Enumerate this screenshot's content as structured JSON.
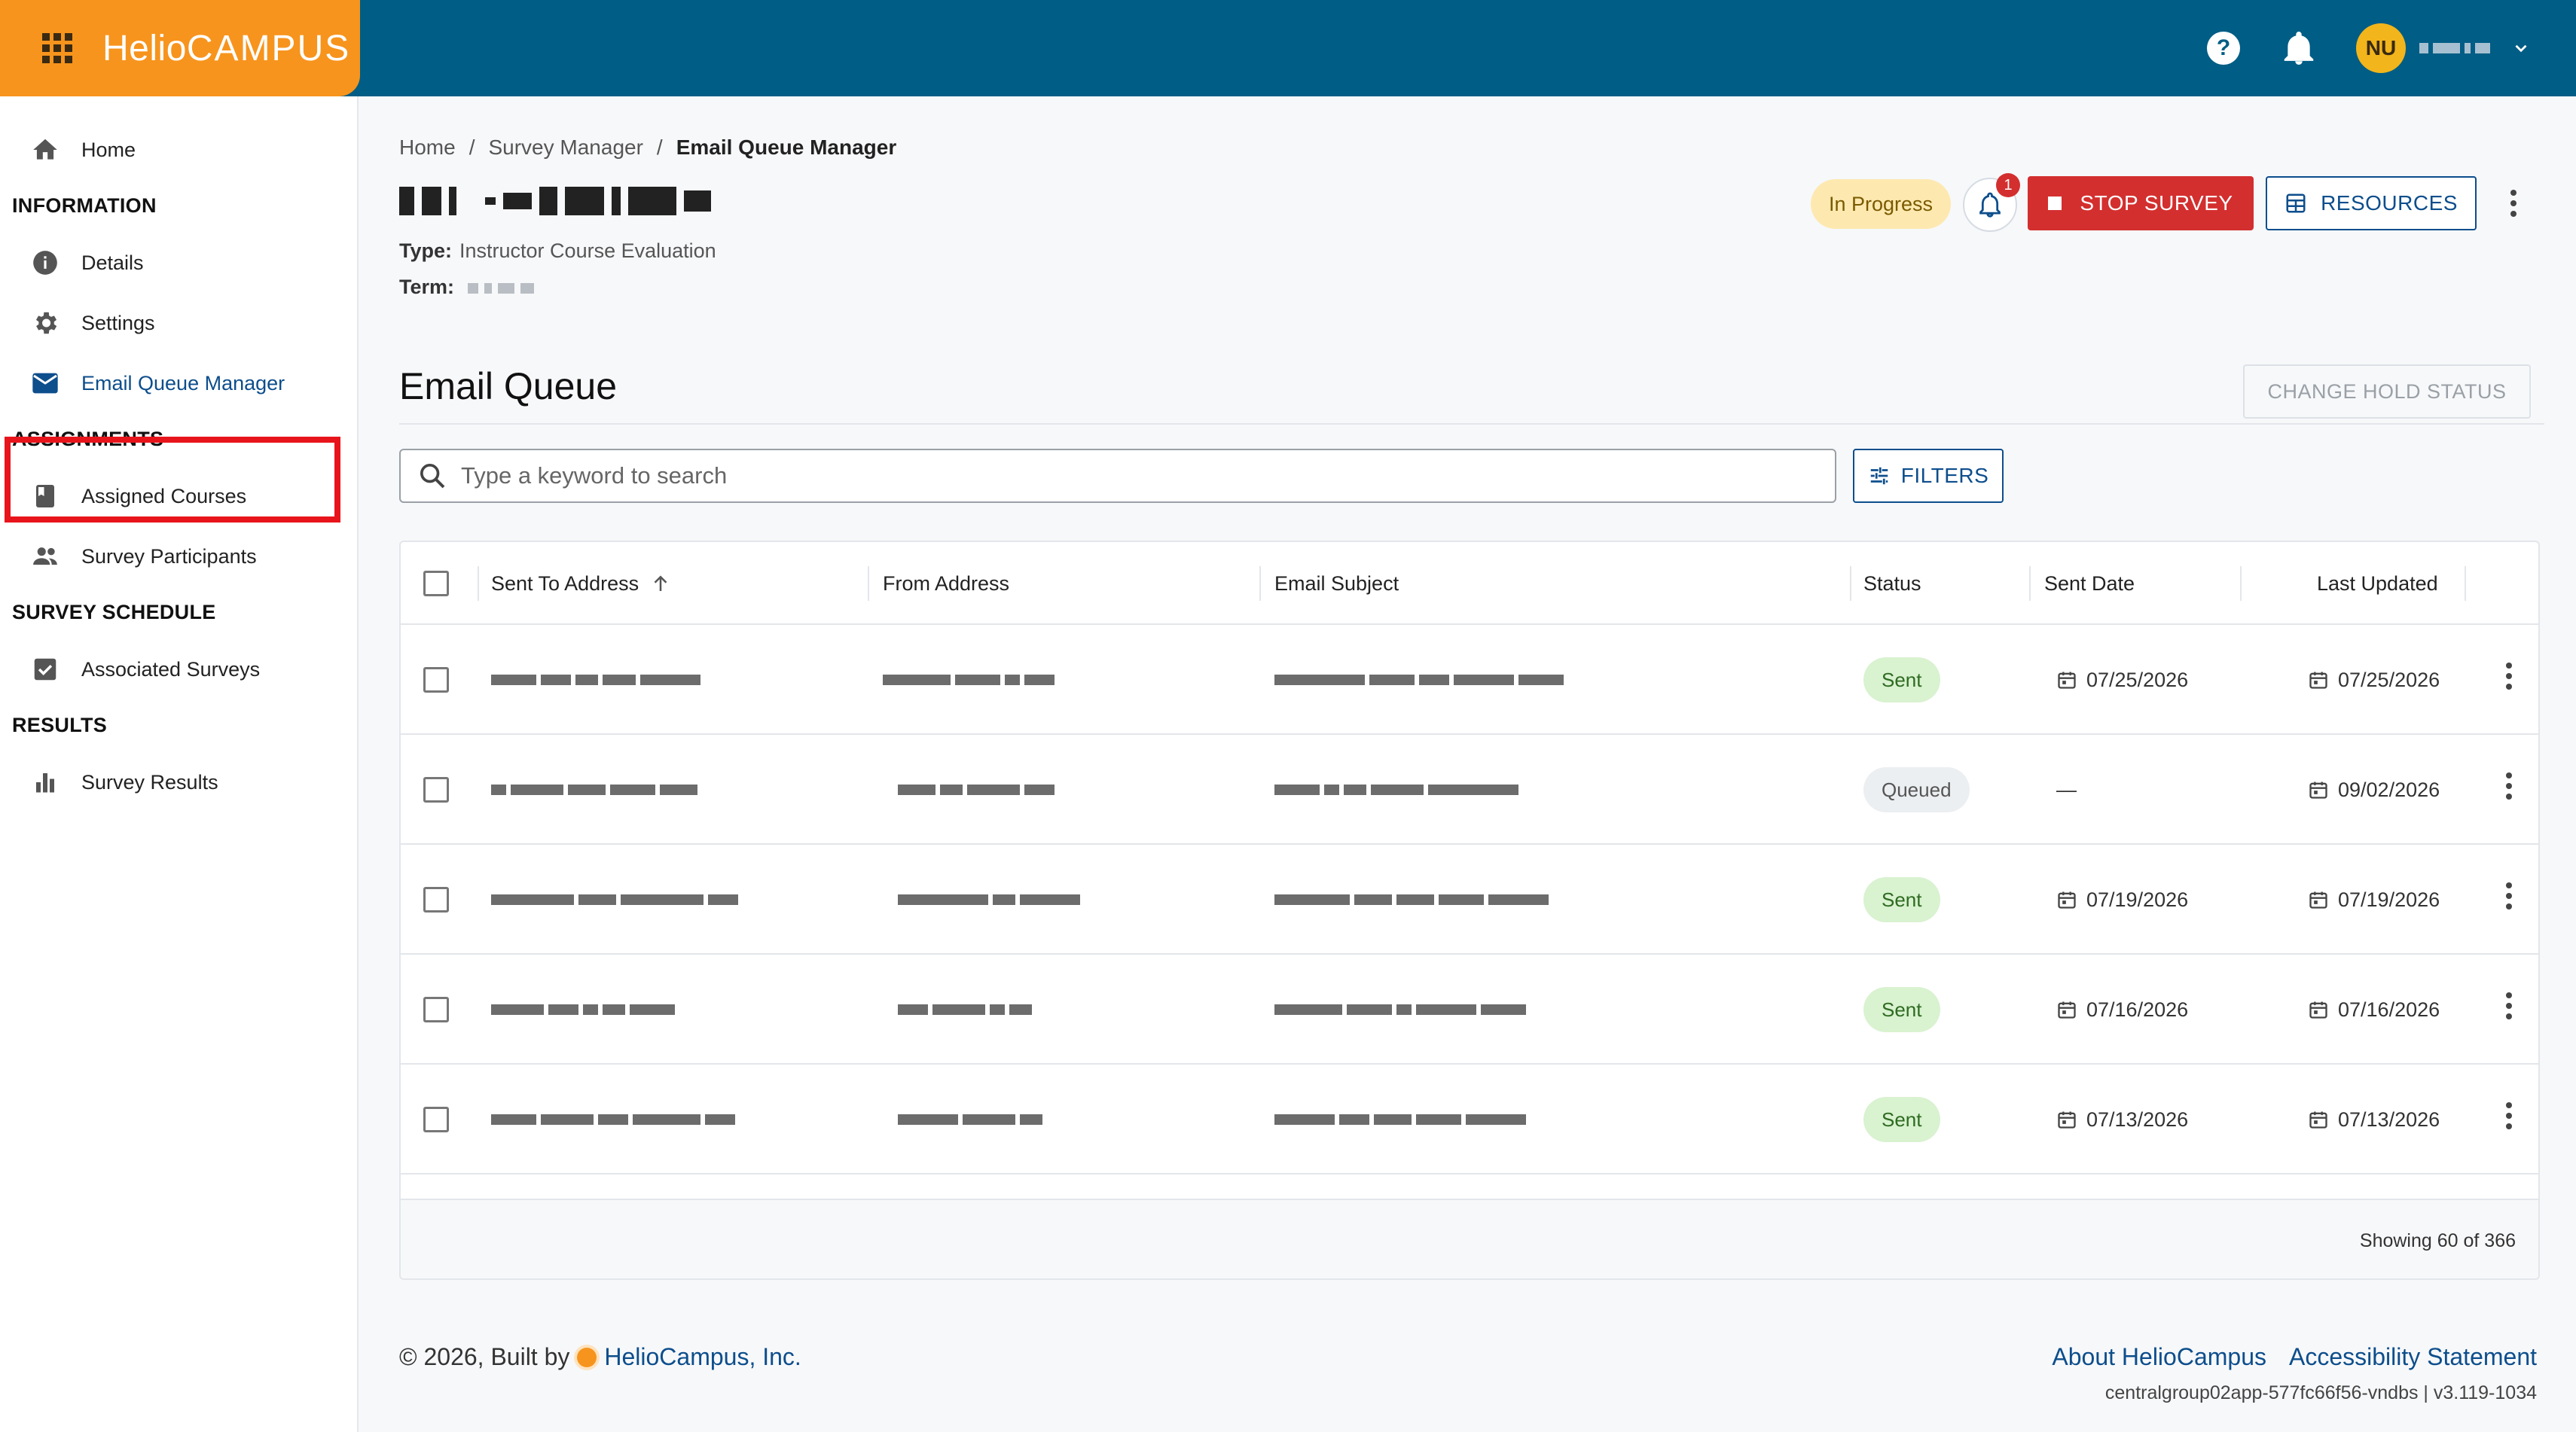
{
  "app": {
    "logo_part1": "Helio",
    "logo_part2": "CAMPUS",
    "user_initials": "NU",
    "brand_color": "#f7941d",
    "topbar_color": "#005d85"
  },
  "sidebar": {
    "home": "Home",
    "section_information": "INFORMATION",
    "details": "Details",
    "settings": "Settings",
    "email_queue_manager": "Email Queue Manager",
    "section_assignments": "ASSIGNMENTS",
    "assigned_courses": "Assigned Courses",
    "survey_participants": "Survey Participants",
    "section_survey_schedule": "SURVEY SCHEDULE",
    "associated_surveys": "Associated Surveys",
    "section_results": "RESULTS",
    "survey_results": "Survey Results"
  },
  "breadcrumb": {
    "home": "Home",
    "sep": "/",
    "survey_manager": "Survey Manager",
    "current": "Email Queue Manager"
  },
  "survey": {
    "type_label": "Type:",
    "type_value": "Instructor Course Evaluation",
    "term_label": "Term:",
    "status": "In Progress",
    "notification_count": "1",
    "stop_label": "STOP SURVEY",
    "resources_label": "RESOURCES"
  },
  "queue": {
    "title": "Email Queue",
    "change_hold_label": "CHANGE HOLD STATUS",
    "search_placeholder": "Type a keyword to search",
    "filters_label": "FILTERS",
    "columns": {
      "sent_to": "Sent To Address",
      "from": "From Address",
      "subject": "Email Subject",
      "status": "Status",
      "sent_date": "Sent Date",
      "last_updated": "Last Updated"
    },
    "rows": [
      {
        "status": "Sent",
        "sent_date": "07/25/2026",
        "last_updated": "07/25/2026"
      },
      {
        "status": "Queued",
        "sent_date": "—",
        "last_updated": "09/02/2026"
      },
      {
        "status": "Sent",
        "sent_date": "07/19/2026",
        "last_updated": "07/19/2026"
      },
      {
        "status": "Sent",
        "sent_date": "07/16/2026",
        "last_updated": "07/16/2026"
      },
      {
        "status": "Sent",
        "sent_date": "07/13/2026",
        "last_updated": "07/13/2026"
      }
    ],
    "showing": "Showing 60 of 366"
  },
  "footer": {
    "copyright": "© 2026, Built by",
    "company": "HelioCampus, Inc.",
    "about": "About HelioCampus",
    "accessibility": "Accessibility Statement",
    "version": "centralgroup02app-577fc66f56-vndbs | v3.119-1034"
  }
}
